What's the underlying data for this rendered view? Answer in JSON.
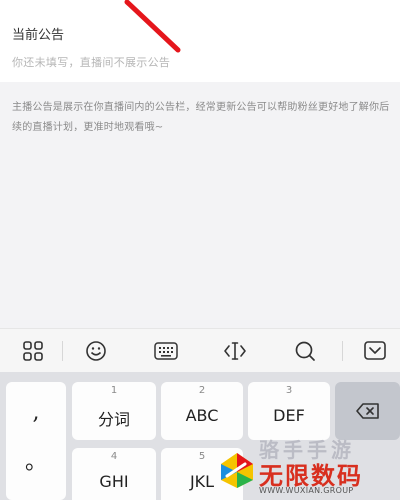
{
  "announcement": {
    "title": "当前公告",
    "placeholder": "你还未填写，直播间不展示公告"
  },
  "hint": "主播公告是展示在你直播间内的公告栏，经常更新公告可以帮助粉丝更好地了解你后续的直播计划，更准时地观看哦~",
  "toolbar": {
    "icons": [
      "grid-icon",
      "emoji-icon",
      "keyboard-icon",
      "cursor-move-icon",
      "search-icon",
      "collapse-keyboard-icon"
    ]
  },
  "keyboard": {
    "punct": [
      ",",
      "。"
    ],
    "keys": [
      {
        "num": "1",
        "label": "分词"
      },
      {
        "num": "2",
        "label": "ABC"
      },
      {
        "num": "3",
        "label": "DEF"
      },
      {
        "num": "4",
        "label": "GHI"
      },
      {
        "num": "5",
        "label": "JKL"
      }
    ]
  },
  "watermark": {
    "faded": "骆手手游",
    "name": "无限数码",
    "url": "WWW.WUXIAN.GROUP"
  },
  "colors": {
    "brand": "#d82f1f",
    "accent_stroke": "#e5161c"
  }
}
